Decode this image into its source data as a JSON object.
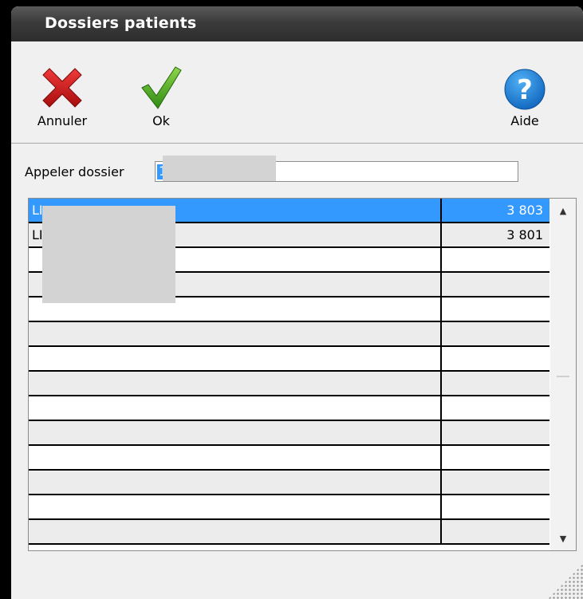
{
  "window": {
    "title": "Dossiers patients"
  },
  "toolbar": {
    "cancel_label": "Annuler",
    "ok_label": "Ok",
    "help_label": "Aide"
  },
  "search": {
    "label": "Appeler dossier",
    "value": "1"
  },
  "list": {
    "rows": [
      {
        "name": "LI",
        "number": "3 803",
        "selected": true
      },
      {
        "name": "LI",
        "number": "3 801",
        "selected": false
      },
      {
        "name": "",
        "number": ""
      },
      {
        "name": "",
        "number": ""
      },
      {
        "name": "",
        "number": ""
      },
      {
        "name": "",
        "number": ""
      },
      {
        "name": "",
        "number": ""
      },
      {
        "name": "",
        "number": ""
      },
      {
        "name": "",
        "number": ""
      },
      {
        "name": "",
        "number": ""
      },
      {
        "name": "",
        "number": ""
      },
      {
        "name": "",
        "number": ""
      },
      {
        "name": "",
        "number": ""
      },
      {
        "name": "",
        "number": ""
      }
    ]
  },
  "colors": {
    "selection": "#3399ff",
    "titlebar": "#3b3b3b"
  }
}
